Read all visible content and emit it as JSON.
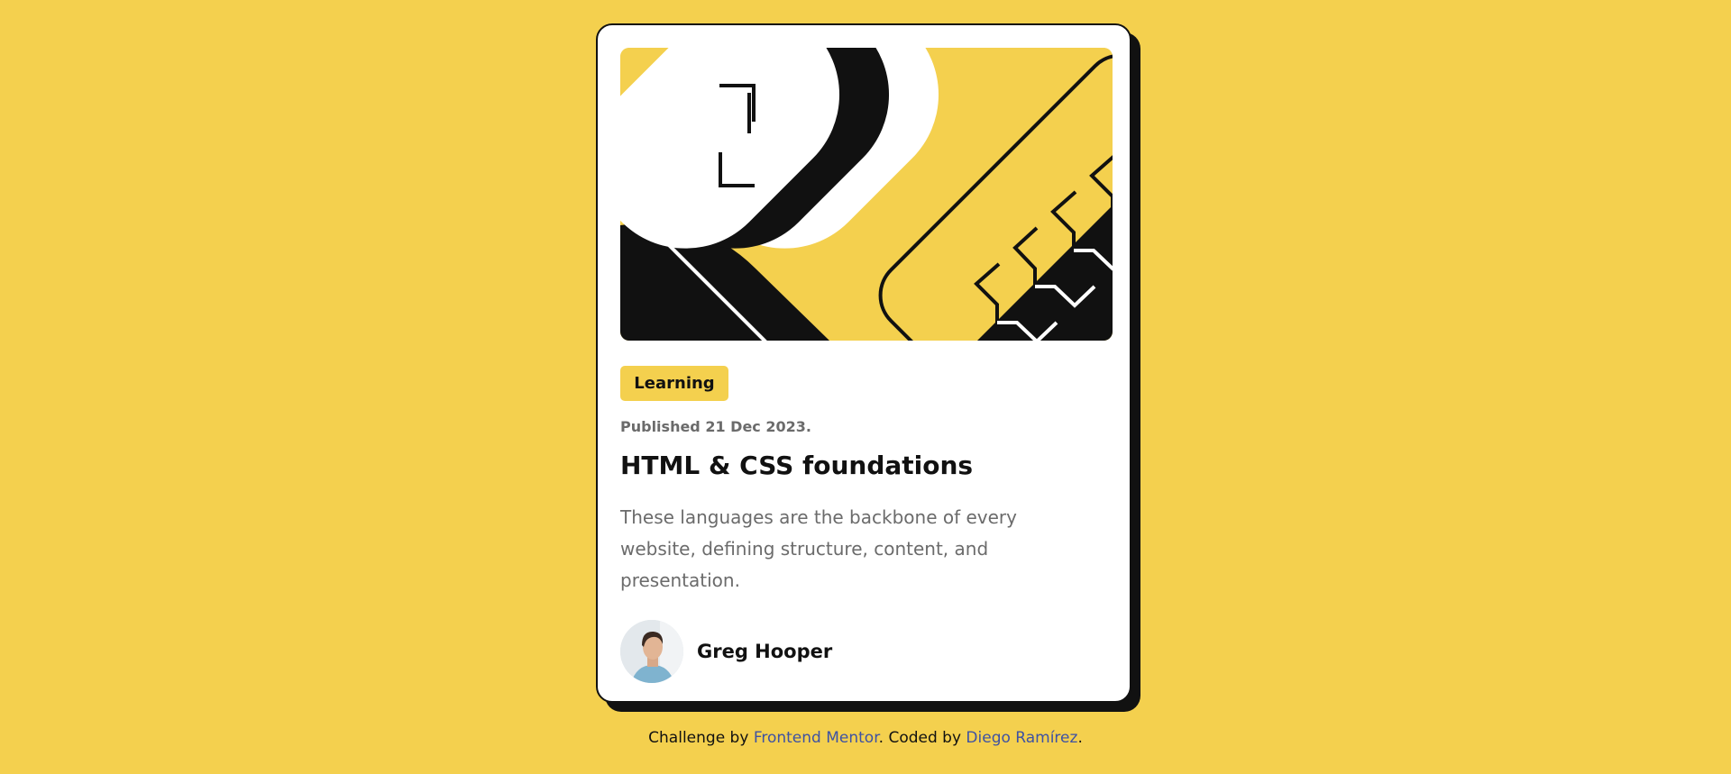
{
  "card": {
    "tag": "Learning",
    "published": "Published 21 Dec 2023.",
    "title": "HTML & CSS foundations",
    "description": "These languages are the backbone of every website, defining structure, content, and presentation.",
    "author": {
      "name": "Greg Hooper"
    }
  },
  "footer": {
    "prefix": "Challenge by ",
    "mentor_link": "Frontend Mentor",
    "middle": ". Coded by ",
    "coder_link": "Diego Ramírez",
    "suffix": "."
  },
  "colors": {
    "background": "#f4d04e",
    "card": "#ffffff",
    "ink": "#111111",
    "muted": "#6b6b6b",
    "link": "#3e52a3"
  }
}
